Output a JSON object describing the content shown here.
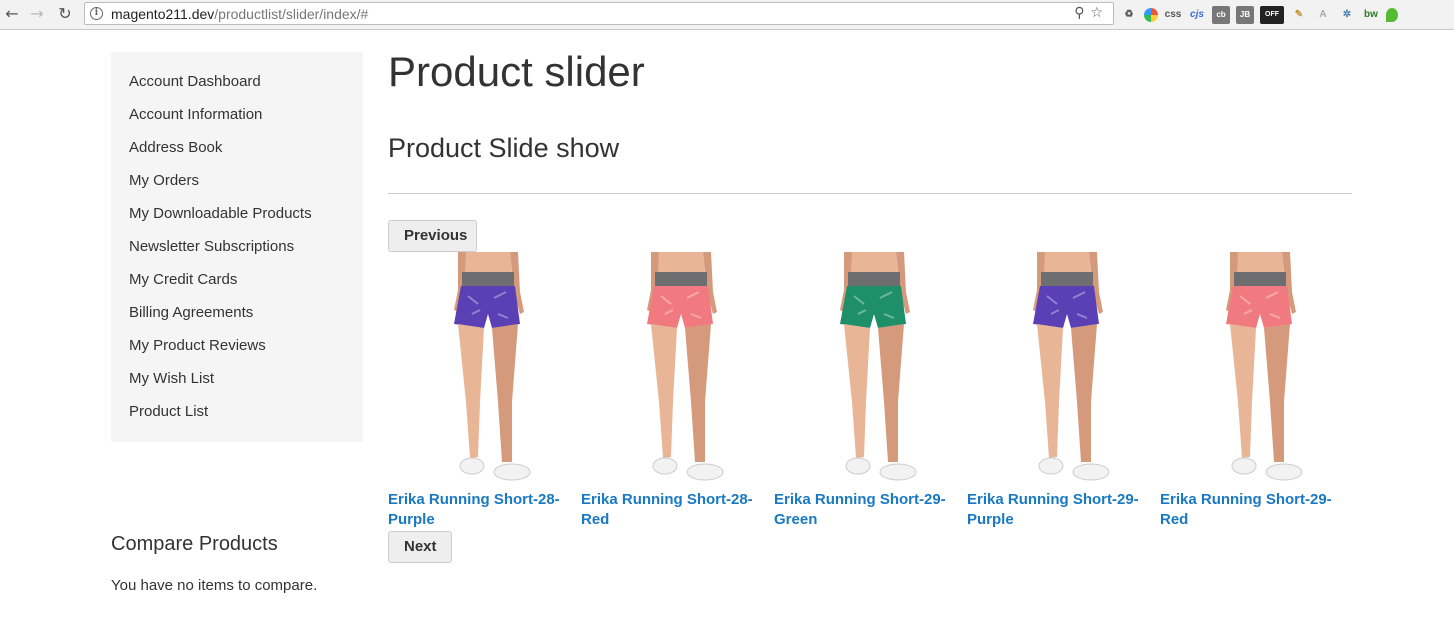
{
  "browser": {
    "url_host": "magento211.dev",
    "url_path": "/productlist/slider/index/#",
    "extensions": [
      "recycle-icon",
      "color-wheel-icon",
      "css",
      "cjs",
      "cb",
      "JB",
      "OFF",
      "pencil-icon",
      "A",
      "gear-icon",
      "bw",
      "leaf-icon"
    ]
  },
  "sidebar": {
    "items": [
      {
        "label": "Account Dashboard"
      },
      {
        "label": "Account Information"
      },
      {
        "label": "Address Book"
      },
      {
        "label": "My Orders"
      },
      {
        "label": "My Downloadable Products"
      },
      {
        "label": "Newsletter Subscriptions"
      },
      {
        "label": "My Credit Cards"
      },
      {
        "label": "Billing Agreements"
      },
      {
        "label": "My Product Reviews"
      },
      {
        "label": "My Wish List"
      },
      {
        "label": "Product List"
      }
    ]
  },
  "compare": {
    "title": "Compare Products",
    "empty_text": "You have no items to compare."
  },
  "main": {
    "page_title": "Product slider",
    "section_title": "Product Slide show",
    "prev_label": "Previous",
    "next_label": "Next",
    "products": [
      {
        "name": "Erika Running Short-28-Purple",
        "color": "#5b3fb5"
      },
      {
        "name": "Erika Running Short-28-Red",
        "color": "#f07a80"
      },
      {
        "name": "Erika Running Short-29-Green",
        "color": "#1f8f6a"
      },
      {
        "name": "Erika Running Short-29-Purple",
        "color": "#5b3fb5"
      },
      {
        "name": "Erika Running Short-29-Red",
        "color": "#f07a80"
      }
    ]
  }
}
